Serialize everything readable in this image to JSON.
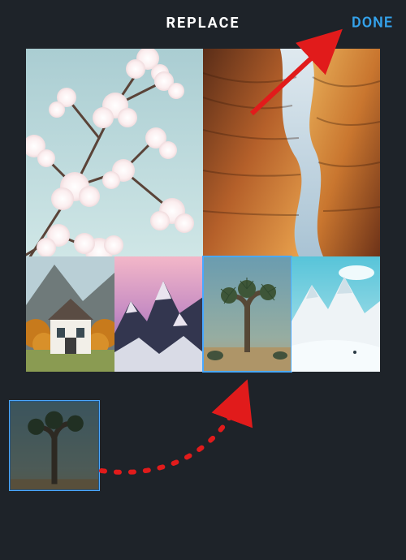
{
  "header": {
    "title": "REPLACE",
    "done_label": "DONE"
  },
  "collage": {
    "tiles": [
      {
        "name": "cherry-blossoms",
        "selected": false
      },
      {
        "name": "antelope-canyon",
        "selected": false
      },
      {
        "name": "autumn-house",
        "selected": false
      },
      {
        "name": "snowy-peak-pink",
        "selected": false
      },
      {
        "name": "joshua-tree",
        "selected": true
      },
      {
        "name": "glacier-peak",
        "selected": false
      }
    ]
  },
  "tray": {
    "thumb": {
      "name": "joshua-tree",
      "selected": true
    }
  },
  "annotations": {
    "arrow_to_done": true,
    "dashed_arrow_tray_to_slot": true
  },
  "colors": {
    "accent": "#34a2eb",
    "selection": "#4aa8ff",
    "annotation": "#e11b1b"
  }
}
